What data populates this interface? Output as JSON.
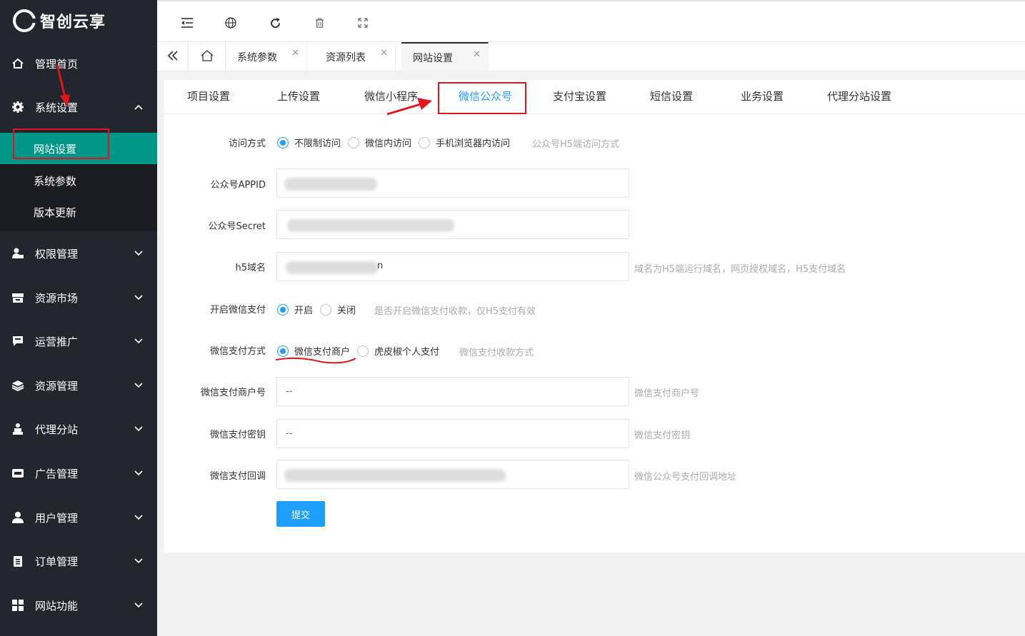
{
  "app": {
    "brand": "智创云享"
  },
  "sidebar": {
    "items": [
      {
        "label": "管理首页",
        "icon": "home-icon"
      },
      {
        "label": "系统设置",
        "icon": "gear-icon"
      },
      {
        "label": "权限管理",
        "icon": "user-lock-icon"
      },
      {
        "label": "资源市场",
        "icon": "store-icon"
      },
      {
        "label": "运营推广",
        "icon": "message-icon"
      },
      {
        "label": "资源管理",
        "icon": "layers-icon"
      },
      {
        "label": "代理分站",
        "icon": "group-icon"
      },
      {
        "label": "广告管理",
        "icon": "ad-icon"
      },
      {
        "label": "用户管理",
        "icon": "user-icon"
      },
      {
        "label": "订单管理",
        "icon": "clipboard-icon"
      },
      {
        "label": "网站功能",
        "icon": "apps-icon"
      }
    ],
    "submenu": [
      {
        "label": "网站设置",
        "active": true
      },
      {
        "label": "系统参数",
        "active": false
      },
      {
        "label": "版本更新",
        "active": false
      }
    ]
  },
  "toolbar": {
    "icons": [
      "menu-fold-icon",
      "globe-icon",
      "refresh-icon",
      "trash-icon",
      "fullscreen-icon"
    ]
  },
  "tabs": [
    {
      "label": "系统参数"
    },
    {
      "label": "资源列表"
    },
    {
      "label": "网站设置",
      "active": true
    }
  ],
  "subtabs": [
    "项目设置",
    "上传设置",
    "微信小程序",
    "微信公众号",
    "支付宝设置",
    "短信设置",
    "业务设置",
    "代理分站设置"
  ],
  "form": {
    "access": {
      "label": "访问方式",
      "options": [
        "不限制访问",
        "微信内访问",
        "手机浏览器内访问"
      ],
      "selected": "不限制访问",
      "hint": "公众号H5端访问方式"
    },
    "appid": {
      "label": "公众号APPID"
    },
    "secret": {
      "label": "公众号Secret"
    },
    "h5domain": {
      "label": "h5域名",
      "hint": "域名为H5端运行域名，网页授权域名，H5支付域名",
      "tail": "n"
    },
    "wxpay": {
      "label": "开启微信支付",
      "options": [
        "开启",
        "关闭"
      ],
      "selected": "开启",
      "hint": "是否开启微信支付收款，仅H5支付有效"
    },
    "paymode": {
      "label": "微信支付方式",
      "options": [
        "微信支付商户",
        "虎皮椒个人支付"
      ],
      "selected": "微信支付商户",
      "hint": "微信支付收款方式"
    },
    "mchid": {
      "label": "微信支付商户号",
      "value": "--",
      "hint": "微信支付商户号"
    },
    "mchkey": {
      "label": "微信支付密钥",
      "value": "--",
      "hint": "微信支付密钥"
    },
    "notify": {
      "label": "微信支付回调",
      "hint": "微信公众号支付回调地址"
    },
    "submit": "提交"
  },
  "colors": {
    "sidebar": "#23262e",
    "active": "#009688",
    "accent": "#1e9fff",
    "annotation": "#e0161c"
  }
}
